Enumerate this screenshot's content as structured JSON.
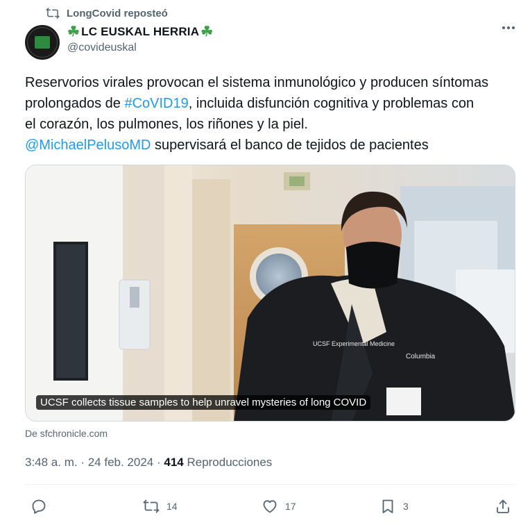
{
  "repost": {
    "label": "LongCovid reposteó"
  },
  "author": {
    "display_name": "LC EUSKAL HERRIA",
    "clover_left": "☘",
    "clover_right": "☘",
    "handle": "@covideuskal"
  },
  "tweet": {
    "line1": "Reservorios virales  provocan el sistema inmunológico y producen síntomas",
    "line2_before": "prolongados de ",
    "hashtag": "#CoVID19",
    "line2_after": ", incluida  disfunción cognitiva y problemas con",
    "line3": "el corazón, los pulmones, los riñones y la piel.",
    "mention": "@MichaelPelusoMD",
    "line4_after": " supervisará el banco de tejidos de pacientes"
  },
  "media": {
    "caption": "UCSF collects tissue samples to help unravel mysteries of long COVID",
    "jacket_text": "UCSF Experimental Medicine",
    "brand_text": "Columbia"
  },
  "source": "De sfchronicle.com",
  "meta": {
    "time": "3:48 a. m.",
    "sep1": " · ",
    "date": "24 feb. 2024",
    "sep2": " · ",
    "views": "414",
    "views_label": " Reproducciones"
  },
  "actions": {
    "replies": "",
    "reposts": "14",
    "likes": "17",
    "bookmarks": "3"
  },
  "colors": {
    "accent": "#1d9bf0",
    "muted": "#536471",
    "text": "#0f1419",
    "clover": "#3aa34a"
  },
  "icons": [
    "repost-icon",
    "more-icon",
    "reply-icon",
    "like-icon",
    "bookmark-icon",
    "share-icon"
  ]
}
